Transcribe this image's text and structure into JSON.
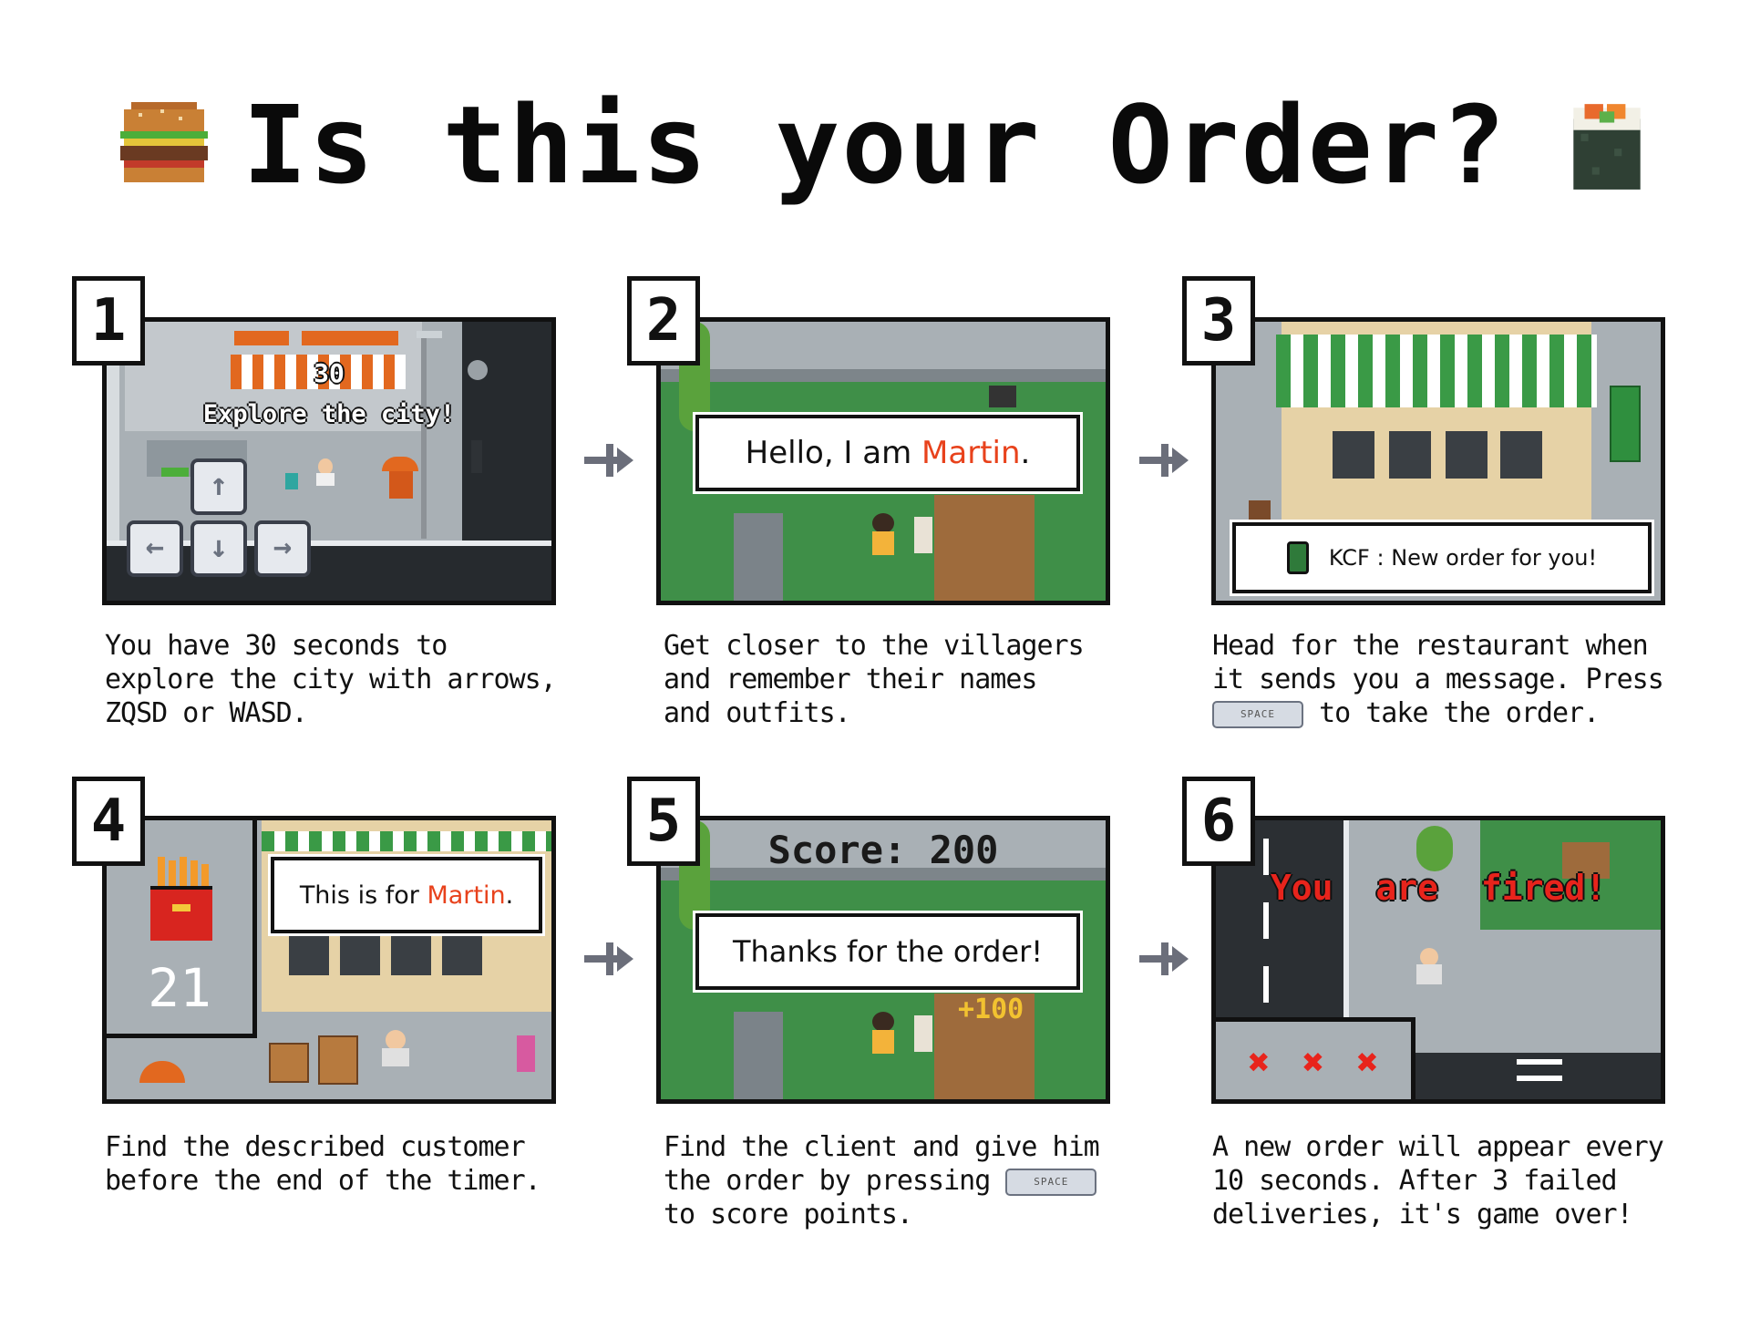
{
  "title": "Is this your Order?",
  "icons": {
    "left": "burger-icon",
    "right": "sushi-roll-icon",
    "connector": "plus-arrow-icon"
  },
  "colors": {
    "accent_red": "#e8421c",
    "grass": "#3f8f48",
    "pavement": "#a9b0b5"
  },
  "steps": [
    {
      "number": "1",
      "panel": {
        "timer": "30",
        "banner": "Explore the city!",
        "keys": [
          "↑",
          "←",
          "↓",
          "→"
        ]
      },
      "desc": [
        "You have 30 seconds to",
        "explore the city with arrows,",
        "ZQSD or WASD."
      ]
    },
    {
      "number": "2",
      "panel": {
        "dialog_prefix": "Hello, I am ",
        "dialog_name": "Martin",
        "dialog_suffix": "."
      },
      "desc": [
        "Get closer to the villagers",
        "and remember their names",
        "and outfits."
      ]
    },
    {
      "number": "3",
      "panel": {
        "notification": "KCF : New order for you!"
      },
      "desc": [
        "Head for the restaurant when",
        "it sends you a message. Press",
        "to take the order."
      ],
      "key_label": "SPACE"
    },
    {
      "number": "4",
      "panel": {
        "timer": "21",
        "dialog_prefix": "This is for ",
        "dialog_name": "Martin",
        "dialog_suffix": "."
      },
      "desc": [
        "Find the described customer",
        "before the end of the timer."
      ]
    },
    {
      "number": "5",
      "panel": {
        "score": "Score: 200",
        "dialog": "Thanks for the order!",
        "bonus": "+100"
      },
      "desc": [
        "Find the client and give him",
        "the order by pressing",
        "to score points."
      ],
      "key_label": "SPACE"
    },
    {
      "number": "6",
      "panel": {
        "banner": "You are fired!",
        "strikes": [
          "✖",
          "✖",
          "✖"
        ]
      },
      "desc": [
        "A new order will appear every",
        "10 seconds. After 3 failed",
        "deliveries, it's game over!"
      ]
    }
  ]
}
